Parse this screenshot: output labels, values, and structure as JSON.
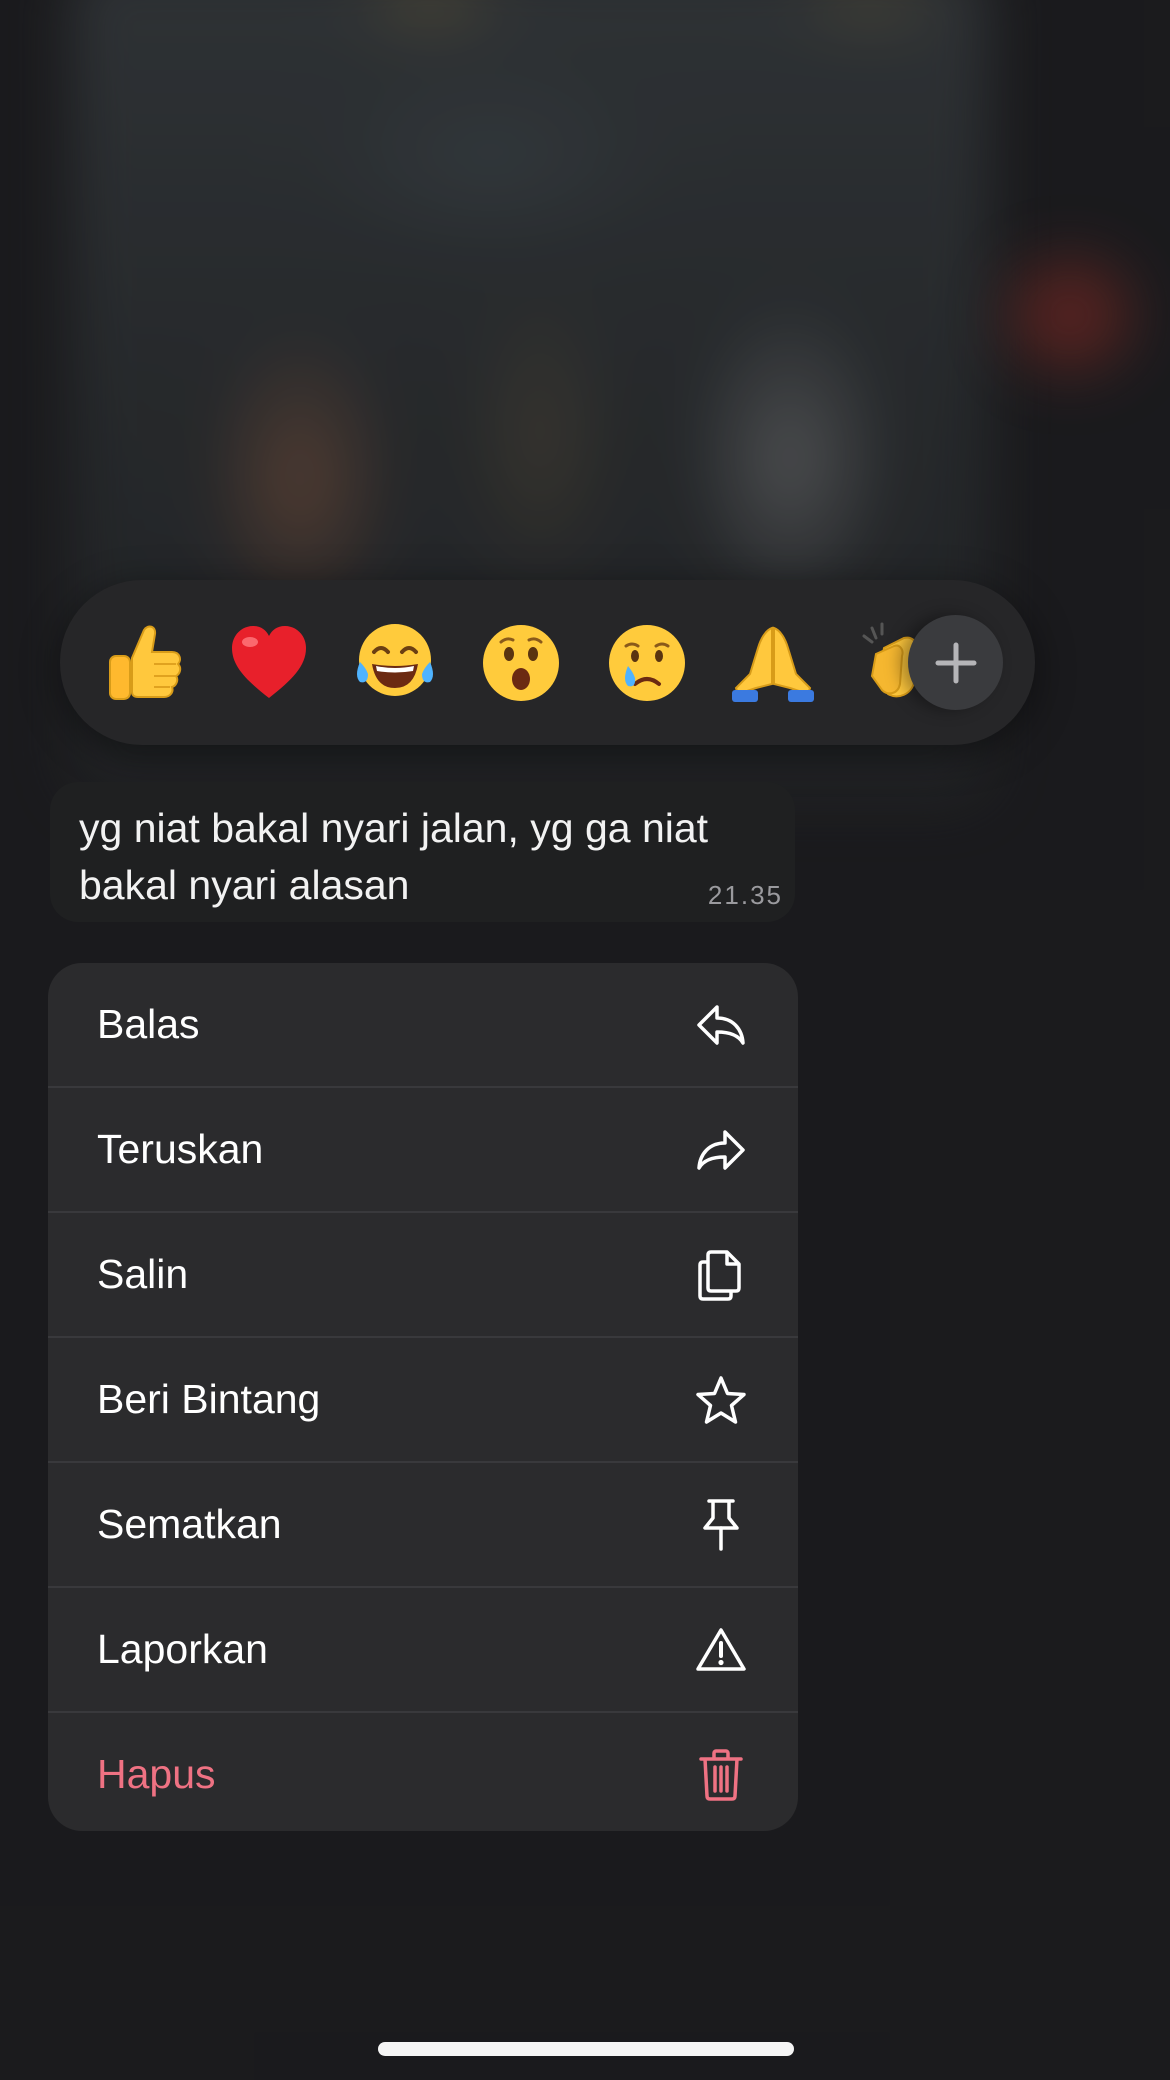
{
  "reactions": {
    "emojis": [
      "👍",
      "❤️",
      "😂",
      "😮",
      "😢",
      "🙏",
      "👏"
    ],
    "emoji_names": [
      "thumbs-up",
      "red-heart",
      "tears-of-joy",
      "surprised-face",
      "crying-face",
      "folded-hands",
      "clapping-hands"
    ],
    "more_icon": "plus-icon"
  },
  "message": {
    "text": "yg niat bakal nyari jalan, yg ga niat bakal nyari alasan",
    "time": "21.35"
  },
  "menu": {
    "items": [
      {
        "label": "Balas",
        "icon": "reply-icon"
      },
      {
        "label": "Teruskan",
        "icon": "forward-icon"
      },
      {
        "label": "Salin",
        "icon": "copy-icon"
      },
      {
        "label": "Beri Bintang",
        "icon": "star-icon"
      },
      {
        "label": "Sematkan",
        "icon": "pin-icon"
      },
      {
        "label": "Laporkan",
        "icon": "warning-icon"
      },
      {
        "label": "Hapus",
        "icon": "trash-icon"
      }
    ]
  },
  "colors": {
    "danger": "#ef7283",
    "menu_background": "#2b2b2d",
    "reaction_bar_background": "#262628"
  }
}
